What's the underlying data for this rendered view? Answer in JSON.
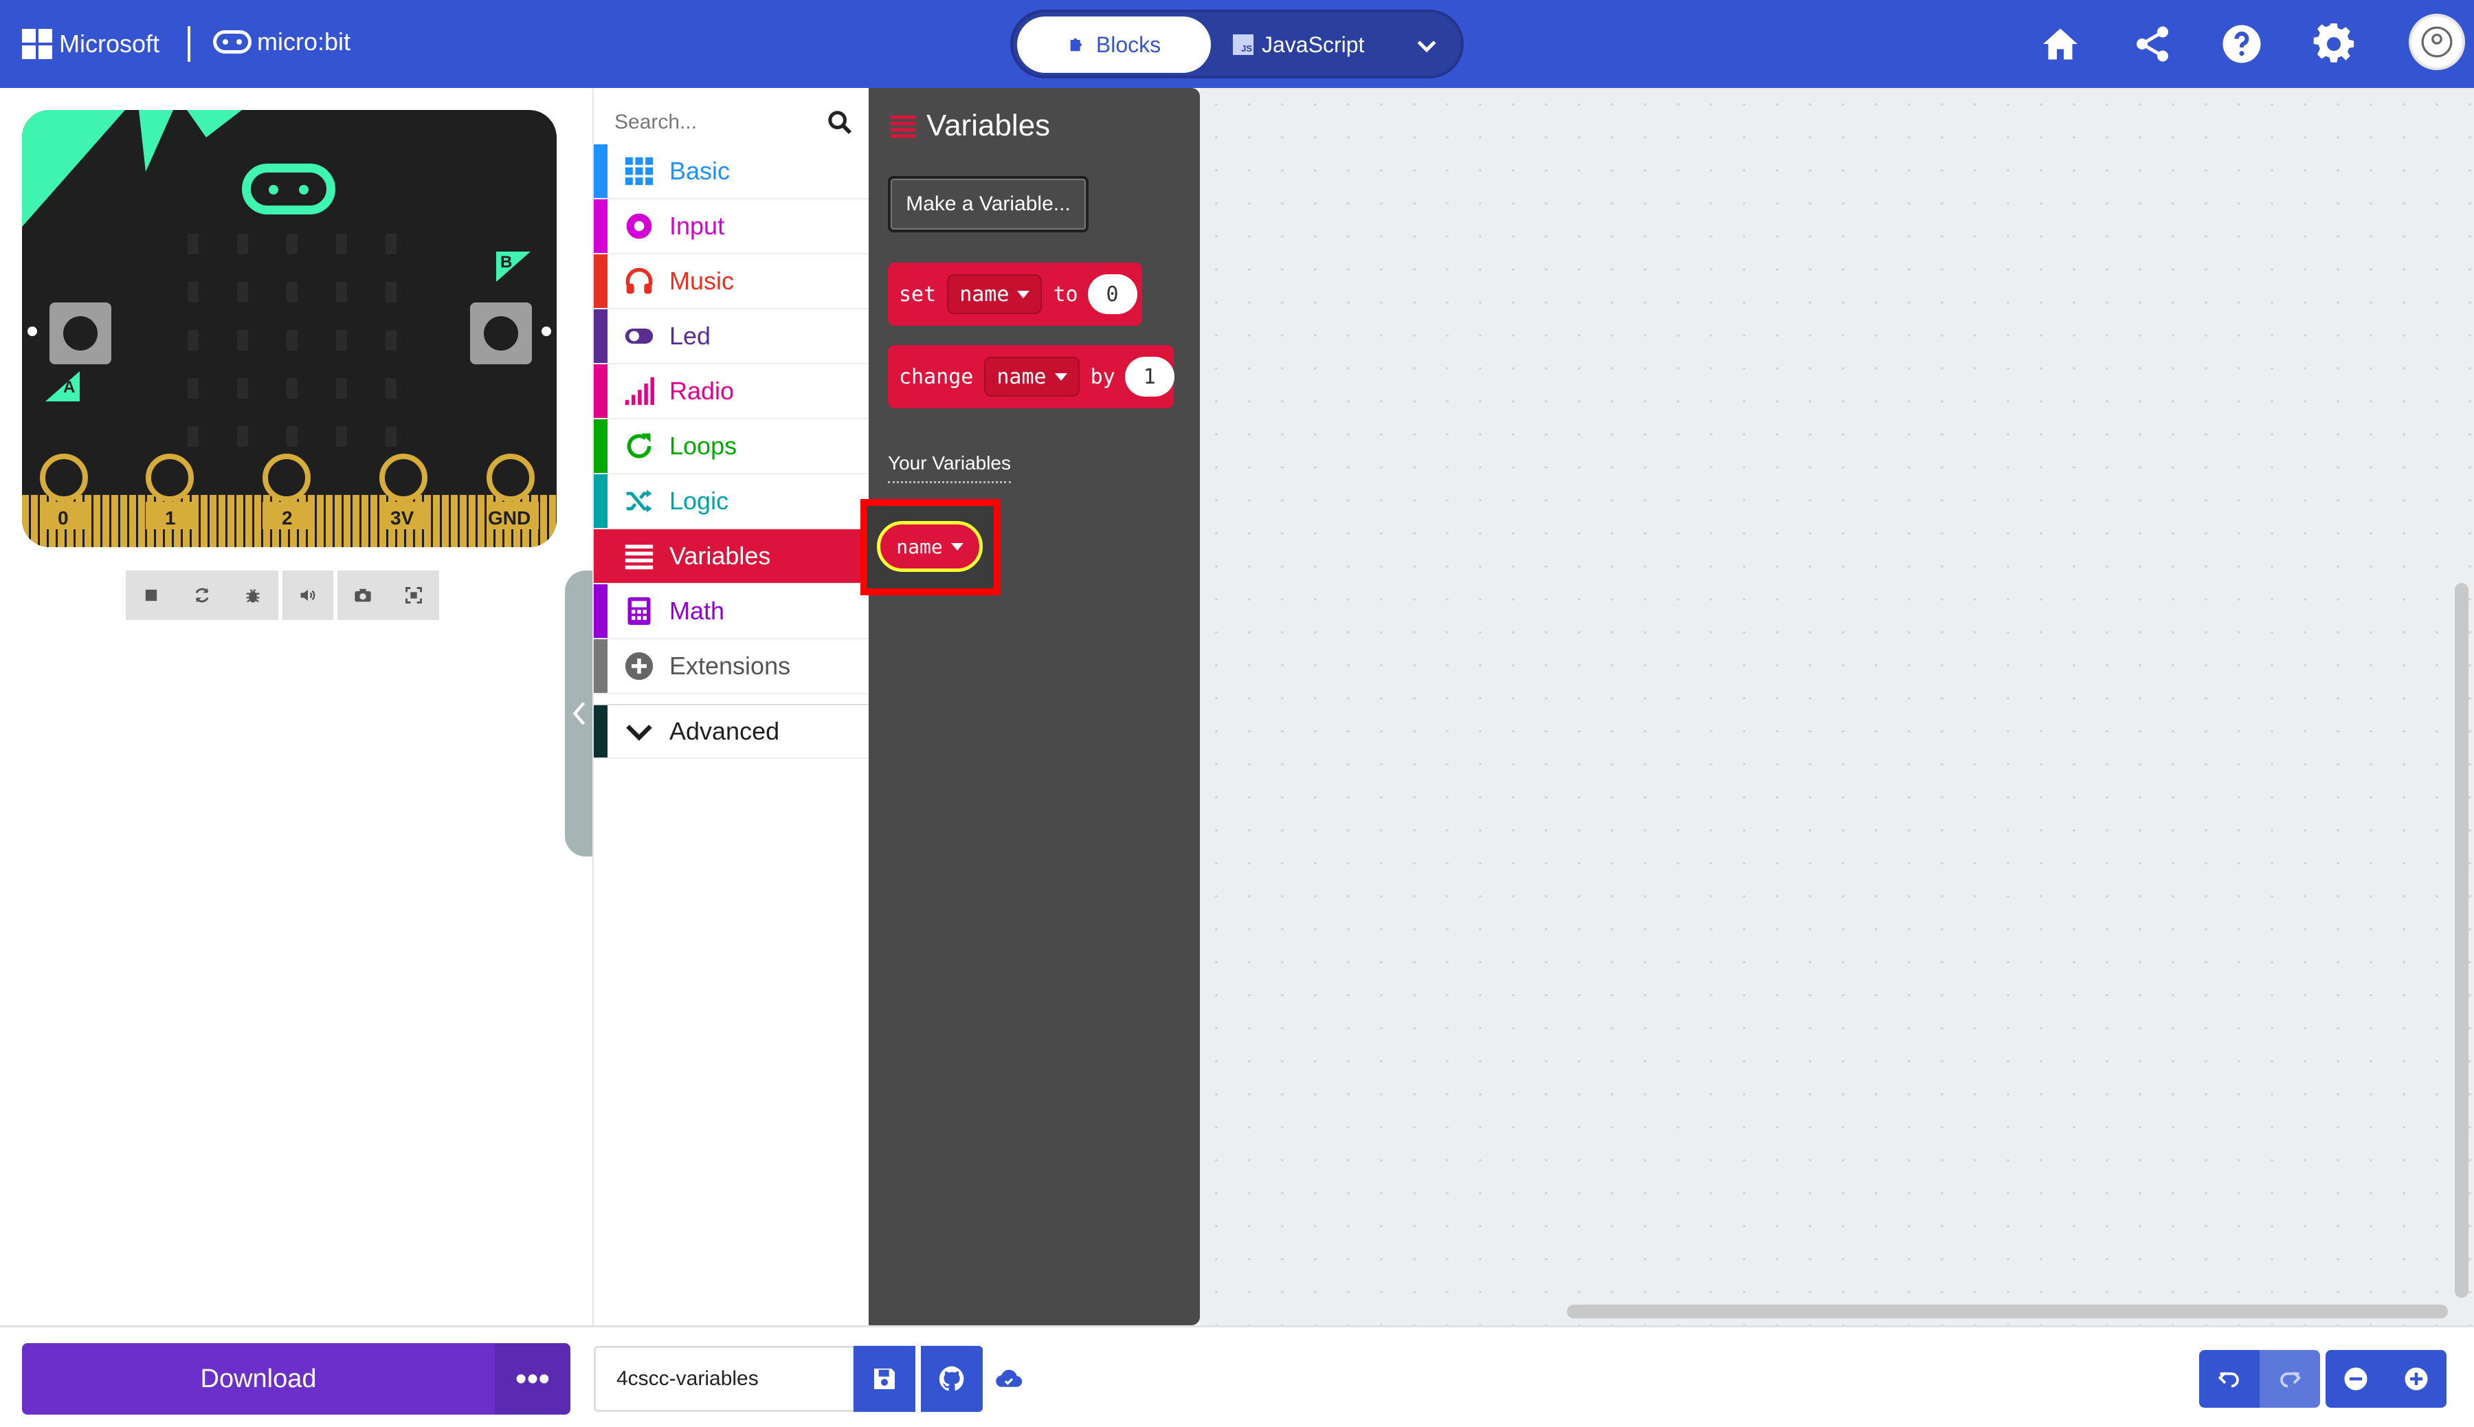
{
  "header": {
    "microsoft_label": "Microsoft",
    "microbit_label": "micro:bit",
    "mode_blocks": "Blocks",
    "mode_javascript": "JavaScript",
    "js_badge": "JS"
  },
  "simulator": {
    "pins": [
      "0",
      "1",
      "2",
      "3V",
      "GND"
    ],
    "button_a": "A",
    "button_b": "B"
  },
  "toolbox": {
    "search_placeholder": "Search...",
    "categories": [
      {
        "label": "Basic",
        "color": "#1e90ff"
      },
      {
        "label": "Input",
        "color": "#d400d4"
      },
      {
        "label": "Music",
        "color": "#e63022"
      },
      {
        "label": "Led",
        "color": "#5c2d91"
      },
      {
        "label": "Radio",
        "color": "#e3008c"
      },
      {
        "label": "Loops",
        "color": "#00aa00"
      },
      {
        "label": "Logic",
        "color": "#00a4a6"
      },
      {
        "label": "Variables",
        "color": "#dc143c"
      },
      {
        "label": "Math",
        "color": "#9400d3"
      },
      {
        "label": "Extensions",
        "color": "#777777"
      },
      {
        "label": "Advanced",
        "color": "#0b3030"
      }
    ]
  },
  "flyout": {
    "title": "Variables",
    "make_variable": "Make a Variable...",
    "set_block": {
      "kw1": "set",
      "var": "name",
      "kw2": "to",
      "value": "0"
    },
    "change_block": {
      "kw1": "change",
      "var": "name",
      "kw2": "by",
      "value": "1"
    },
    "your_variables": "Your Variables",
    "variable_reporter": "name"
  },
  "footer": {
    "download": "Download",
    "more": "•••",
    "project_name": "4cscc-variables"
  },
  "colors": {
    "header_blue": "#3454d1",
    "download_purple": "#6a30c9",
    "variables_red": "#dc143c"
  }
}
